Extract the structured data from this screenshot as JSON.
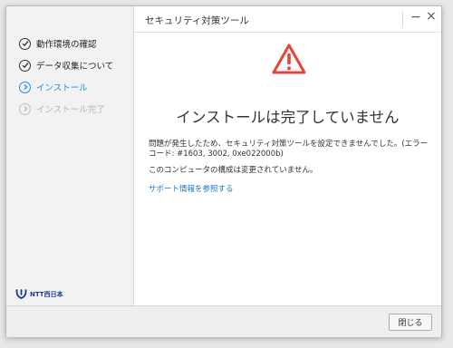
{
  "window": {
    "title": "セキュリティ対策ツール",
    "minimize_glyph": "−",
    "close_glyph": "×"
  },
  "steps": [
    {
      "label": "動作環境の確認",
      "state": "done"
    },
    {
      "label": "データ収集について",
      "state": "done"
    },
    {
      "label": "インストール",
      "state": "active"
    },
    {
      "label": "インストール完了",
      "state": "inactive"
    }
  ],
  "brand": {
    "text": "NTT西日本",
    "color": "#1b3a8a"
  },
  "main": {
    "icon": "warning-icon",
    "headline": "インストールは完了していません",
    "error_message": "問題が発生したため、セキュリティ対策ツールを設定できませんでした。(エラーコード: #1603, 3002, 0xe022000b)",
    "unchanged_message": "このコンピュータの構成は変更されていません。",
    "support_link": "サポート情報を参照する"
  },
  "footer": {
    "close_label": "閉じる"
  },
  "colors": {
    "accent": "#1d8fd6",
    "warning": "#e8423a",
    "link": "#1d78c9"
  }
}
